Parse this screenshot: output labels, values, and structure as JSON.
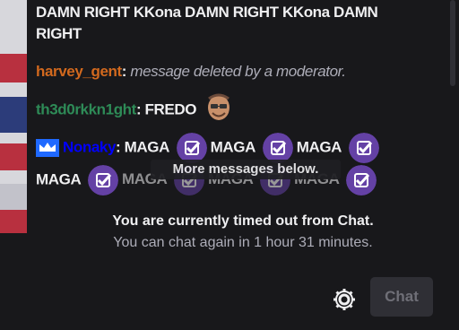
{
  "messages": {
    "top_text_1": "DAMN RIGHT KKona DAMN RIGHT KKona DAMN",
    "top_text_2": "RIGHT",
    "deleted_user": "harvey_gent",
    "deleted_sep": ": ",
    "deleted_text": "message deleted by a moderator.",
    "deleted_user_color": "#d2691e",
    "msg2_user": "th3d0rkkn1ght",
    "msg2_sep": ": ",
    "msg2_text": "FREDO",
    "msg2_user_color": "#2e8b57",
    "msg3_user": "Nonaky",
    "msg3_user_color": "#0000ff",
    "maga": "MAGA"
  },
  "overlay": {
    "more_messages_label": "More messages below."
  },
  "timeout": {
    "title": "You are currently timed out from Chat.",
    "subtitle": "You can chat again in 1 hour 31 minutes."
  },
  "controls": {
    "chat_button_label": "Chat",
    "settings_icon": "gear-icon"
  },
  "colors": {
    "verified_badge": "#6441a5",
    "background": "#18181b"
  }
}
